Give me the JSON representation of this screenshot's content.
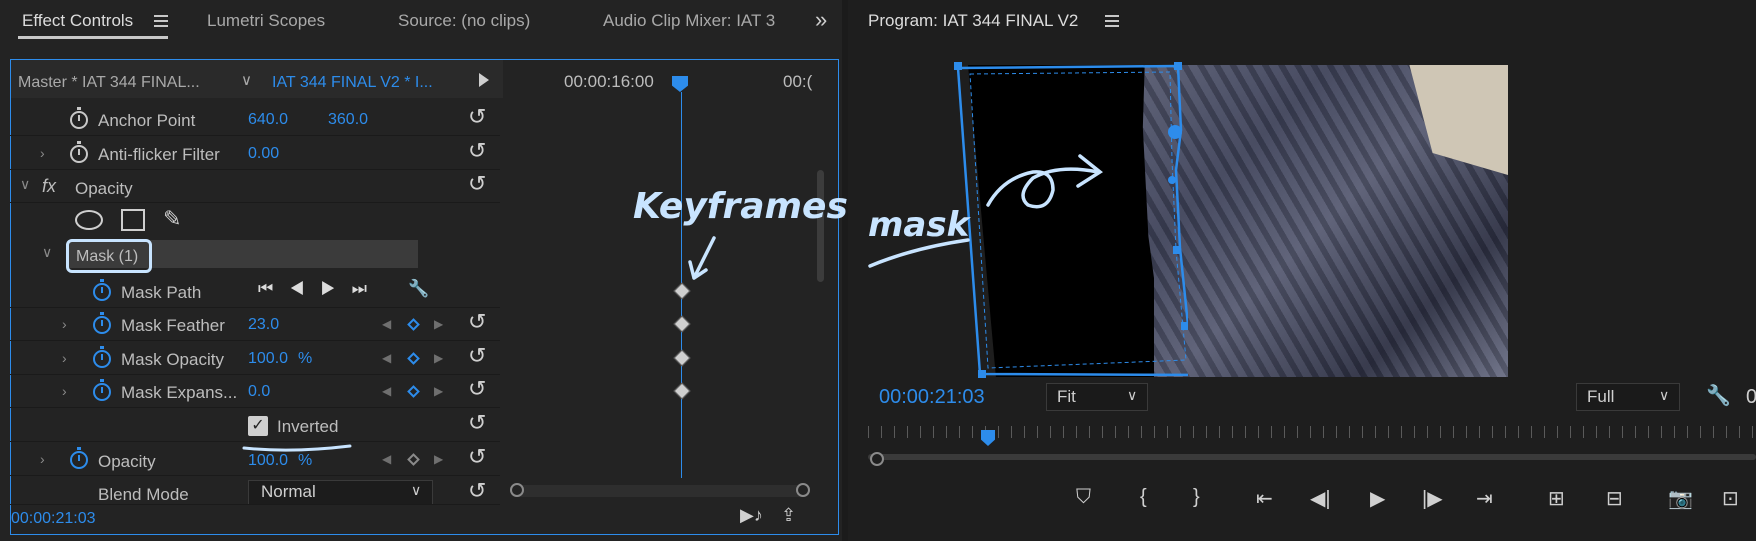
{
  "effect_controls": {
    "tabs": [
      "Effect Controls",
      "Lumetri Scopes",
      "Source: (no clips)",
      "Audio Clip Mixer: IAT 3"
    ],
    "overflow": "»",
    "source_master": "Master * IAT 344 FINAL...",
    "sequence": "IAT 344 FINAL V2 * I...",
    "timeline_times": [
      "00:00:16:00",
      "00:("
    ],
    "rows": {
      "anchor_point": {
        "label": "Anchor Point",
        "v1": "640.0",
        "v2": "360.0"
      },
      "anti_flicker": {
        "label": "Anti-flicker Filter",
        "value": "0.00"
      },
      "opacity_fx": {
        "label": "Opacity",
        "fx": "fx"
      },
      "mask": {
        "label": "Mask (1)"
      },
      "mask_path": {
        "label": "Mask Path"
      },
      "mask_feather": {
        "label": "Mask Feather",
        "value": "23.0"
      },
      "mask_opacity": {
        "label": "Mask Opacity",
        "value": "100.0",
        "unit": "%"
      },
      "mask_expansion": {
        "label": "Mask Expans...",
        "value": "0.0"
      },
      "inverted": {
        "label": "Inverted",
        "checked": true
      },
      "opacity": {
        "label": "Opacity",
        "value": "100.0",
        "unit": "%"
      },
      "blend_mode": {
        "label": "Blend Mode",
        "value": "Normal"
      }
    },
    "current_time": "00:00:21:03",
    "annotation": "Keyframes"
  },
  "program_monitor": {
    "title": "Program: IAT 344 FINAL V2",
    "timecode": "00:00:21:03",
    "fit": "Fit",
    "quality": "Full",
    "duration_partial": "0",
    "annotation": "mask"
  },
  "colors": {
    "accent": "#2d8ceb",
    "panel_bg": "#232323",
    "annotation": "#c8e4ff"
  }
}
